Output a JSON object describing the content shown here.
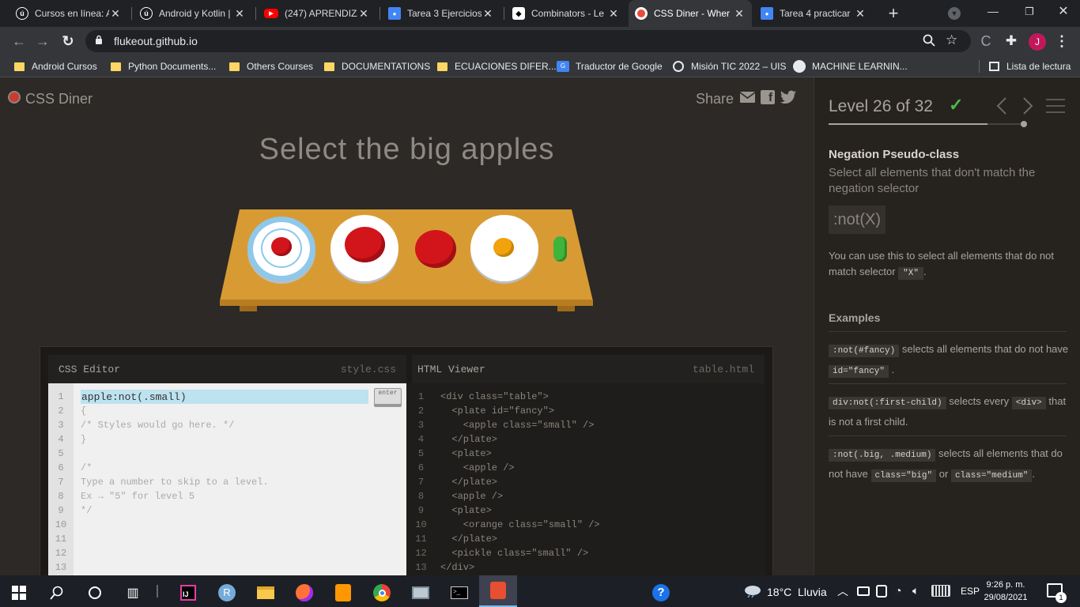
{
  "browser": {
    "tabs": [
      {
        "label": "Cursos en línea: A",
        "icon": "udemy-icon",
        "color": "#ffffff",
        "active": false
      },
      {
        "label": "Android y Kotlin |",
        "icon": "udemy-icon",
        "color": "#ffffff",
        "active": false
      },
      {
        "label": "(247) APRENDIZA",
        "icon": "youtube-icon",
        "color": "#ff0000",
        "active": false
      },
      {
        "label": "Tarea 3 Ejercicios",
        "icon": "classroom-icon",
        "color": "#4285f4",
        "active": false
      },
      {
        "label": "Combinators - Le",
        "icon": "combinators-icon",
        "color": "#ffffff",
        "active": false
      },
      {
        "label": "CSS Diner - Wher",
        "icon": "css-diner-icon",
        "color": "#e84c3d",
        "active": true
      },
      {
        "label": "Tarea 4 practicar",
        "icon": "classroom-icon",
        "color": "#4285f4",
        "active": false
      }
    ],
    "url": "flukeout.github.io",
    "profile_initial": "J",
    "bookmarks": [
      {
        "label": "Android Cursos",
        "icon": "folder-icon"
      },
      {
        "label": "Python Documents...",
        "icon": "folder-icon"
      },
      {
        "label": "Others Courses",
        "icon": "folder-icon"
      },
      {
        "label": "DOCUMENTATIONS",
        "icon": "folder-icon"
      },
      {
        "label": "ECUACIONES DIFER...",
        "icon": "folder-icon"
      },
      {
        "label": "Traductor de Google",
        "icon": "google-translate-icon"
      },
      {
        "label": "Misión TIC 2022 – UIS",
        "icon": "globe-icon"
      },
      {
        "label": "MACHINE LEARNIN...",
        "icon": "github-icon"
      }
    ],
    "reading_list": "Lista de lectura"
  },
  "game": {
    "logo": "CSS Diner",
    "share": "Share",
    "instruction": "Select the big apples",
    "table_items": [
      "apple small on fancy plate",
      "apple on plate",
      "apple",
      "orange small on plate",
      "pickle small"
    ],
    "css_editor": {
      "title": "CSS Editor",
      "file": "style.css",
      "enter": "enter",
      "line_numbers": [
        "1",
        "2",
        "3",
        "4",
        "5",
        "6",
        "7",
        "8",
        "9",
        "10",
        "11",
        "12",
        "13"
      ],
      "input_value": "apple:not(.small)",
      "lines": [
        "",
        "{",
        "/* Styles would go here. */",
        "}",
        "",
        "/*",
        "Type a number to skip to a level.",
        "Ex → \"5\" for level 5",
        "*/",
        "",
        "",
        "",
        ""
      ]
    },
    "html_viewer": {
      "title": "HTML Viewer",
      "file": "table.html",
      "line_numbers": [
        "1",
        "2",
        "3",
        "4",
        "5",
        "6",
        "7",
        "8",
        "9",
        "10",
        "11",
        "12",
        "13"
      ],
      "lines": [
        "<div class=\"table\">",
        "  <plate id=\"fancy\">",
        "    <apple class=\"small\" />",
        "  </plate>",
        "  <plate>",
        "    <apple />",
        "  </plate>",
        "  <apple />",
        "  <plate>",
        "    <orange class=\"small\" />",
        "  </plate>",
        "  <pickle class=\"small\" />",
        "</div>"
      ]
    },
    "level": {
      "label": "Level 26 of 32",
      "current": 26,
      "total": 32,
      "complete": true
    },
    "lesson": {
      "title": "Negation Pseudo-class",
      "subtitle": "Select all elements that don't match the negation selector",
      "syntax": ":not(X)",
      "desc_before": "You can use this to select all elements that do not match selector",
      "desc_code": "\"X\"",
      "desc_after": ".",
      "examples_title": "Examples",
      "examples": [
        {
          "code1": ":not(#fancy)",
          "text1": "selects all elements that do not have",
          "code2": "id=\"fancy\"",
          "text2": ".",
          "code3": "",
          "text3": ""
        },
        {
          "code1": "div:not(:first-child)",
          "text1": "selects every",
          "code2": "<div>",
          "text2": "that is not a first child.",
          "code3": "",
          "text3": ""
        },
        {
          "code1": ":not(.big, .medium)",
          "text1": "selects all elements that do not have",
          "code2": "class=\"big\"",
          "text2": "or",
          "code3": "class=\"medium\"",
          "text3": "."
        }
      ]
    }
  },
  "taskbar": {
    "weather": "18°C  Lluvia",
    "language": "ESP",
    "time": "9:26 p. m.",
    "date": "29/08/2021",
    "notifications": "1",
    "intellij_label": "IJ",
    "r_label": "R"
  },
  "colors": {
    "accent_green": "#4cbb4a",
    "table": "#d89b33",
    "apple": "#d2151b",
    "highlight": "#bde2f0"
  }
}
